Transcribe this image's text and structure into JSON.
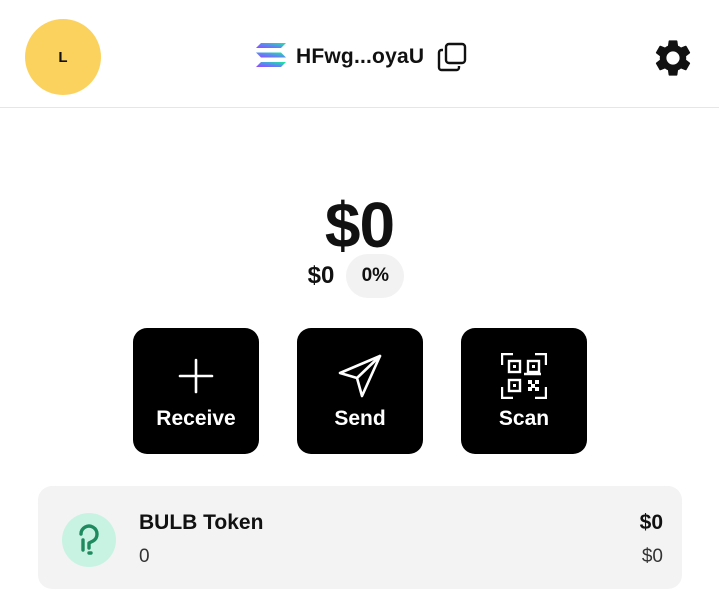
{
  "header": {
    "avatar_letter": "L",
    "wallet_address": "HFwg...oyaU",
    "network_icon": "solana-icon",
    "copy_icon": "copy-icon",
    "settings_icon": "gear-icon"
  },
  "balance": {
    "total": "$0",
    "change_value": "$0",
    "change_percent": "0%"
  },
  "actions": [
    {
      "label": "Receive",
      "icon": "plus-icon"
    },
    {
      "label": "Send",
      "icon": "send-icon"
    },
    {
      "label": "Scan",
      "icon": "qr-scan-icon"
    }
  ],
  "tokens": [
    {
      "name": "BULB Token",
      "amount": "0",
      "value": "$0",
      "value_sub": "$0",
      "icon": "bulb-token-icon"
    }
  ],
  "colors": {
    "avatar": "#fcd25f",
    "button_bg": "#000000",
    "token_row_bg": "#f3f3f3",
    "token_logo_bg": "#c8f3e3",
    "token_logo_fg": "#1e8a5e"
  }
}
